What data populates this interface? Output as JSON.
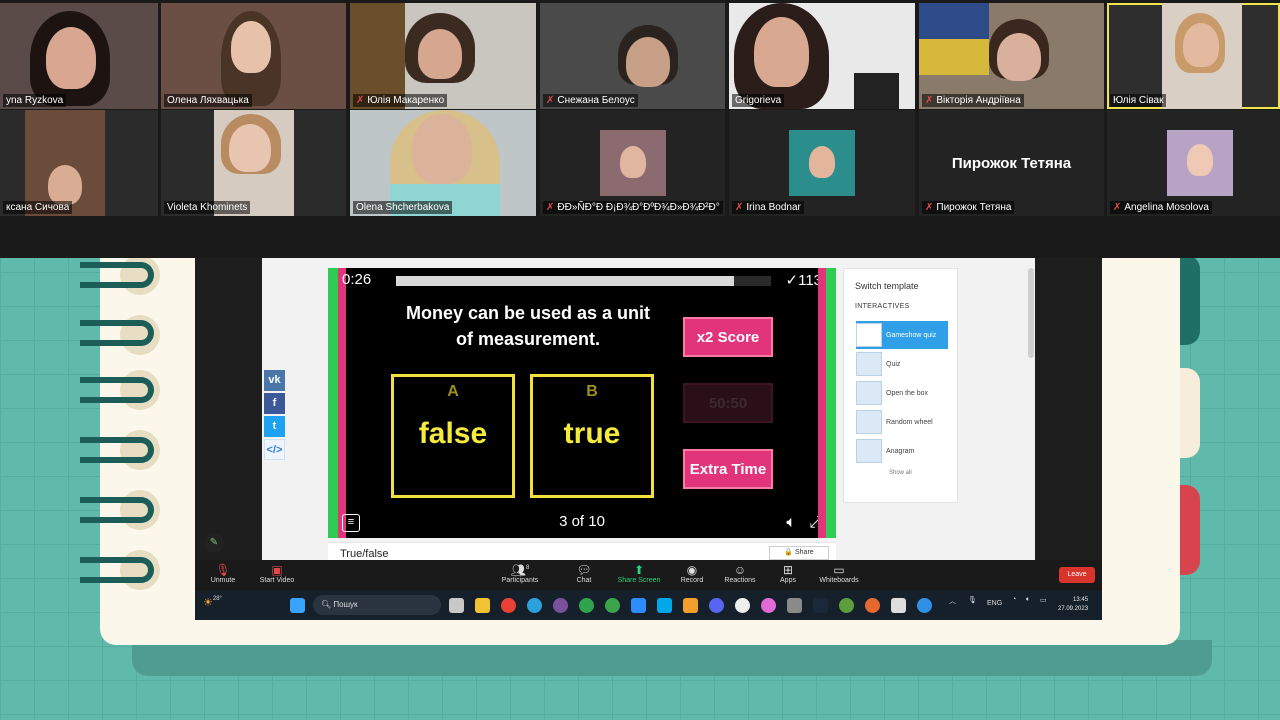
{
  "participants": [
    {
      "name": "yna Ryzkova",
      "muted": false
    },
    {
      "name": "Олена Ляхвацька",
      "muted": false
    },
    {
      "name": "Юлія Макаренко",
      "muted": true
    },
    {
      "name": "Снежана Белоус",
      "muted": true
    },
    {
      "name": "Grigorieva",
      "muted": false
    },
    {
      "name": "Вікторія Андріївна",
      "muted": true
    },
    {
      "name": "Юлія Сівак",
      "muted": false
    },
    {
      "name": "ксана Сичова",
      "muted": false
    },
    {
      "name": "Violeta Khominets",
      "muted": false
    },
    {
      "name": "Olena Shcherbakova",
      "muted": false
    },
    {
      "name": "ÐÐ»ÑÐ°Ð Ð¡Ð¾Ð°ÐºÐ¾Ð»Ð¾Ð²Ð°",
      "muted": true
    },
    {
      "name": "Irina Bodnar",
      "muted": true
    },
    {
      "name": "Пирожок Тетяна",
      "muted": true,
      "video_off_label": "Пирожок Тетяна"
    },
    {
      "name": "Angelina Mosolova",
      "muted": true
    }
  ],
  "game": {
    "timer": "0:26",
    "progress": 0.9,
    "score": "✓113",
    "question": "Money can be used as a unit of measurement.",
    "answers": [
      {
        "letter": "A",
        "text": "false"
      },
      {
        "letter": "B",
        "text": "true"
      }
    ],
    "powerups": [
      {
        "label": "x2 Score",
        "enabled": true
      },
      {
        "label": "50:50",
        "enabled": false
      },
      {
        "label": "Extra Time",
        "enabled": true
      }
    ],
    "counter": "3 of 10",
    "menu_icon": "menu-icon",
    "sound_icon": "speaker-icon",
    "fullscreen_icon": "fullscreen-icon"
  },
  "template_panel": {
    "title": "Switch template",
    "subtitle": "INTERACTIVES",
    "items": [
      "Gameshow quiz",
      "Quiz",
      "Open the box",
      "Random wheel",
      "Anagram"
    ],
    "selected": "Gameshow quiz",
    "show_all": "Show all"
  },
  "activity": {
    "type_label": "True/false",
    "share_label": "Share"
  },
  "social": [
    "vk",
    "f",
    "t",
    "</>"
  ],
  "zoom_toolbar": {
    "unmute": "Unmute",
    "start_video": "Start Video",
    "participants": "Participants",
    "participants_count": "8",
    "chat": "Chat",
    "share_screen": "Share Screen",
    "record": "Record",
    "reactions": "Reactions",
    "apps": "Apps",
    "whiteboards": "Whiteboards",
    "leave": "Leave"
  },
  "taskbar": {
    "weather": "28°",
    "search_placeholder": "Пошук",
    "lang": "ENG",
    "time": "13:45",
    "date": "27.09.2023"
  },
  "colors": {
    "accent_green": "#2ecc53",
    "accent_pink": "#e2347a",
    "answer_yellow": "#f5eb3b",
    "leave_red": "#d9342b"
  }
}
